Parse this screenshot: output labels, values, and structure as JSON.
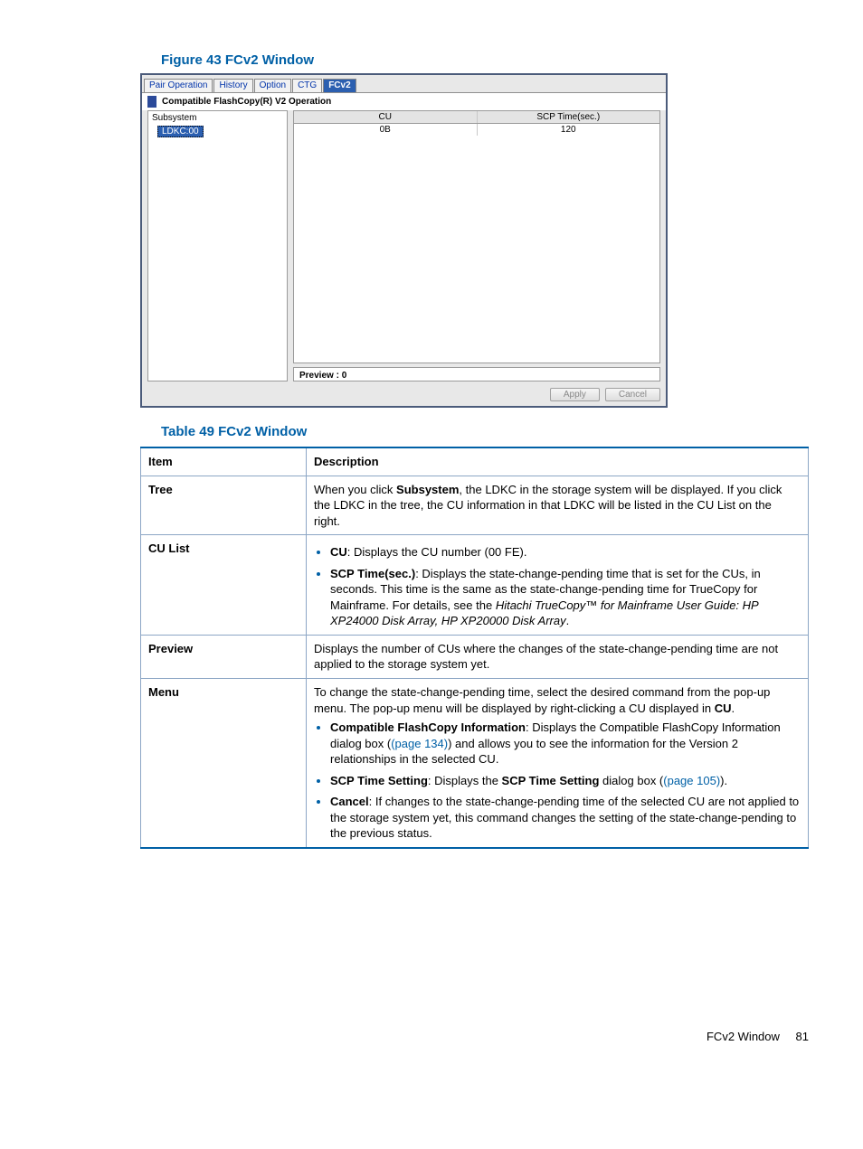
{
  "figure": {
    "title": "Figure 43 FCv2 Window",
    "tabs": [
      "Pair Operation",
      "History",
      "Option",
      "CTG",
      "FCv2"
    ],
    "active_tab": "FCv2",
    "panel_title": "Compatible FlashCopy(R) V2 Operation",
    "tree": {
      "root": "Subsystem",
      "node": "LDKC:00"
    },
    "grid": {
      "headers": [
        "CU",
        "SCP Time(sec.)"
      ],
      "row": [
        "0B",
        "120"
      ]
    },
    "preview_label": "Preview : 0",
    "buttons": {
      "apply": "Apply",
      "cancel": "Cancel"
    }
  },
  "table": {
    "title": "Table 49 FCv2 Window",
    "headers": [
      "Item",
      "Description"
    ],
    "rows": {
      "tree": {
        "label": "Tree",
        "p1a": "When you click ",
        "p1b": "Subsystem",
        "p1c": ", the LDKC in the storage system will be displayed. If you click the LDKC in the tree, the CU information in that LDKC will be listed in the CU List on the right."
      },
      "culist": {
        "label": "CU List",
        "b1a": "CU",
        "b1b": ": Displays the CU number (00 FE).",
        "b2a": "SCP Time(sec.)",
        "b2b": ": Displays the state-change-pending time that is set for the CUs, in seconds. This time is the same as the state-change-pending time for TrueCopy for Mainframe. For details, see the ",
        "b2c": "Hitachi TrueCopy™ for Mainframe User Guide: HP XP24000 Disk Array, HP XP20000 Disk Array",
        "b2d": "."
      },
      "preview": {
        "label": "Preview",
        "text": "Displays the number of CUs where the changes of the state-change-pending time are not applied to the storage system yet."
      },
      "menu": {
        "label": "Menu",
        "intro_a": "To change the state-change-pending time, select the desired command from the pop-up menu. The pop-up menu will be displayed by right-clicking a CU displayed in ",
        "intro_b": "CU",
        "intro_c": ".",
        "m1a": "Compatible FlashCopy Information",
        "m1b": ": Displays the Compatible FlashCopy Information dialog box (",
        "m1c": "(page 134)",
        "m1d": ") and allows you to see the information for the Version 2 relationships in the selected CU.",
        "m2a": "SCP Time Setting",
        "m2b": ": Displays the ",
        "m2c": "SCP Time Setting",
        "m2d": " dialog box (",
        "m2e": "(page 105)",
        "m2f": ").",
        "m3a": "Cancel",
        "m3b": ": If changes to the state-change-pending time of the selected CU are not applied to the storage system yet, this command changes the setting of the state-change-pending to the previous status."
      }
    }
  },
  "footer": {
    "section": "FCv2 Window",
    "page": "81"
  }
}
